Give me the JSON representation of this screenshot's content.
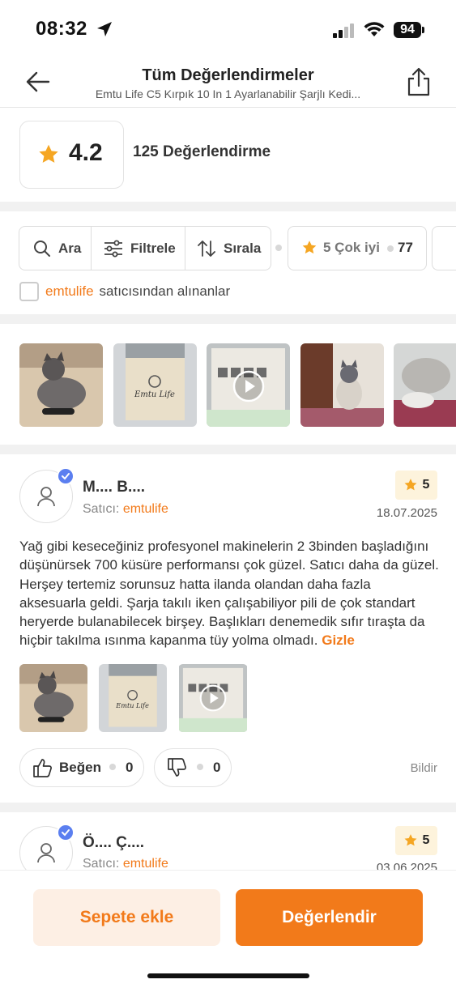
{
  "status_bar": {
    "time": "08:32",
    "battery": "94"
  },
  "header": {
    "title": "Tüm Değerlendirmeler",
    "subtitle": "Emtu Life C5 Kırpık 10 In 1 Ayarlanabilir Şarjlı Kedi..."
  },
  "summary": {
    "rating": "4.2",
    "review_count": "125 Değerlendirme"
  },
  "toolbar": {
    "search_label": "Ara",
    "filter_label": "Filtrele",
    "sort_label": "Sırala",
    "star_chip_label": "5 Çok iyi",
    "star_chip_count": "77"
  },
  "seller_filter": {
    "seller": "emtulife",
    "suffix": "satıcısından alınanlar"
  },
  "gallery": {
    "brand_text": "Emtu Life",
    "items": [
      "cat-photo",
      "clipper-photo",
      "video",
      "siamese-cat-photo",
      "cat-fur-photo"
    ]
  },
  "reviews": [
    {
      "author": "M.... B....",
      "seller_label": "Satıcı:",
      "seller": "emtulife",
      "score": "5",
      "date": "18.07.2025",
      "text": "Yağ gibi keseceğiniz profesyonel makinelerin 2 3binden başladığını düşünürsek 700 küsüre performansı çok güzel. Satıcı daha da güzel. Herşey tertemiz sorunsuz hatta ilanda olandan daha fazla aksesuarla geldi. Şarja takılı iken çalışabiliyor pili de çok standart heryerde bulanabilecek birşey. Başlıkları denemedik sıfır tıraşta da hiçbir takılma ısınma kapanma tüy yolma olmadı.",
      "hide_label": "Gizle",
      "like_label": "Beğen",
      "like_count": "0",
      "dislike_count": "0",
      "report_label": "Bildir"
    },
    {
      "author": "Ö.... Ç....",
      "seller_label": "Satıcı:",
      "seller": "emtulife",
      "score": "5",
      "date": "03.06.2025"
    }
  ],
  "bottom_bar": {
    "cart_label": "Sepete ekle",
    "rate_label": "Değerlendir"
  },
  "colors": {
    "accent": "#f27a1a",
    "star": "#f5a623",
    "verified": "#5b7ff0"
  }
}
